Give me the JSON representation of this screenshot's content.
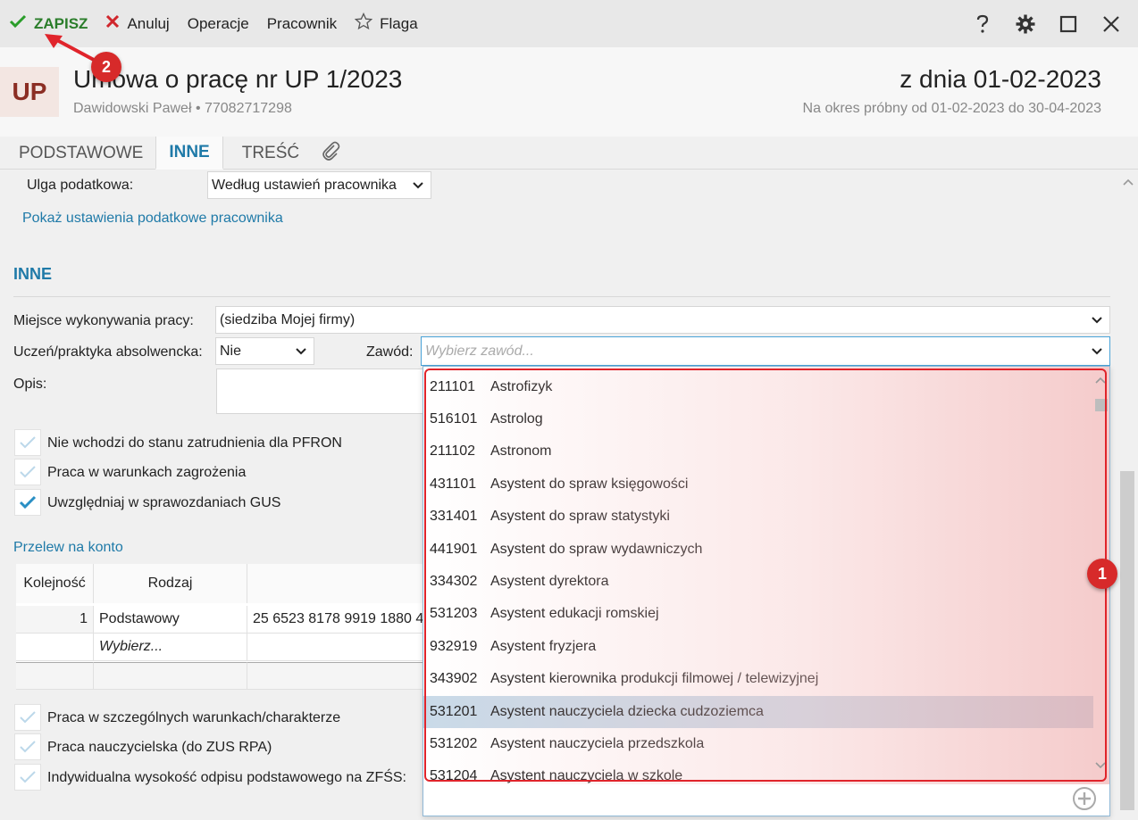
{
  "toolbar": {
    "save_label": "ZAPISZ",
    "cancel_label": "Anuluj",
    "operations_label": "Operacje",
    "employee_label": "Pracownik",
    "flag_label": "Flaga"
  },
  "header": {
    "badge": "UP",
    "title": "Umowa o pracę nr UP 1/2023",
    "subtitle": "Dawidowski Paweł  •  77082717298",
    "date": "z dnia 01-02-2023",
    "period": "Na okres próbny od 01-02-2023 do 30-04-2023"
  },
  "tabs": [
    {
      "label": "PODSTAWOWE"
    },
    {
      "label": "INNE"
    },
    {
      "label": "TREŚĆ"
    }
  ],
  "tax": {
    "label": "Ulga podatkowa:",
    "value": "Według ustawień pracownika",
    "link": "Pokaż ustawienia podatkowe pracownika"
  },
  "inne": {
    "section_title": "INNE",
    "workplace_label": "Miejsce wykonywania pracy:",
    "workplace_value": "(siedziba Mojej firmy)",
    "apprentice_label": "Uczeń/praktyka absolwencka:",
    "apprentice_value": "Nie",
    "occupation_label": "Zawód:",
    "occupation_placeholder": "Wybierz zawód...",
    "description_label": "Opis:"
  },
  "checkboxes_top": [
    {
      "label": "Nie wchodzi do stanu zatrudnienia dla PFRON",
      "checked": false
    },
    {
      "label": "Praca w warunkach zagrożenia",
      "checked": false
    },
    {
      "label": "Uwzględniaj w sprawozdaniach GUS",
      "checked": true
    }
  ],
  "transfer": {
    "link": "Przelew na konto",
    "col_order": "Kolejność",
    "col_type": "Rodzaj",
    "row1_order": "1",
    "row1_type": "Podstawowy",
    "row1_account": "25 6523 8178 9919 1880 4",
    "row2_placeholder": "Wybierz..."
  },
  "checkboxes_bottom": [
    {
      "label": "Praca w szczególnych warunkach/charakterze",
      "checked": false
    },
    {
      "label": "Praca nauczycielska (do ZUS RPA)",
      "checked": false
    },
    {
      "label": "Indywidualna wysokość odpisu podstawowego na ZFŚS:",
      "checked": false
    }
  ],
  "occupations": [
    {
      "code": "211101",
      "name": "Astrofizyk"
    },
    {
      "code": "516101",
      "name": "Astrolog"
    },
    {
      "code": "211102",
      "name": "Astronom"
    },
    {
      "code": "431101",
      "name": "Asystent do spraw księgowości"
    },
    {
      "code": "331401",
      "name": "Asystent do spraw statystyki"
    },
    {
      "code": "441901",
      "name": "Asystent do spraw wydawniczych"
    },
    {
      "code": "334302",
      "name": "Asystent dyrektora"
    },
    {
      "code": "531203",
      "name": "Asystent edukacji romskiej"
    },
    {
      "code": "932919",
      "name": "Asystent fryzjera"
    },
    {
      "code": "343902",
      "name": "Asystent kierownika produkcji filmowej / telewizyjnej"
    },
    {
      "code": "531201",
      "name": "Asystent nauczyciela dziecka cudzoziemca"
    },
    {
      "code": "531202",
      "name": "Asystent nauczyciela przedszkola"
    },
    {
      "code": "531204",
      "name": "Asystent nauczyciela w szkole"
    }
  ],
  "selected_occupation_index": 10,
  "annotations": {
    "badge1": "1",
    "badge2": "2"
  },
  "colors": {
    "accent": "#1f7aa8",
    "save_green": "#2a7d2a",
    "annotation_red": "#d72a2a"
  }
}
